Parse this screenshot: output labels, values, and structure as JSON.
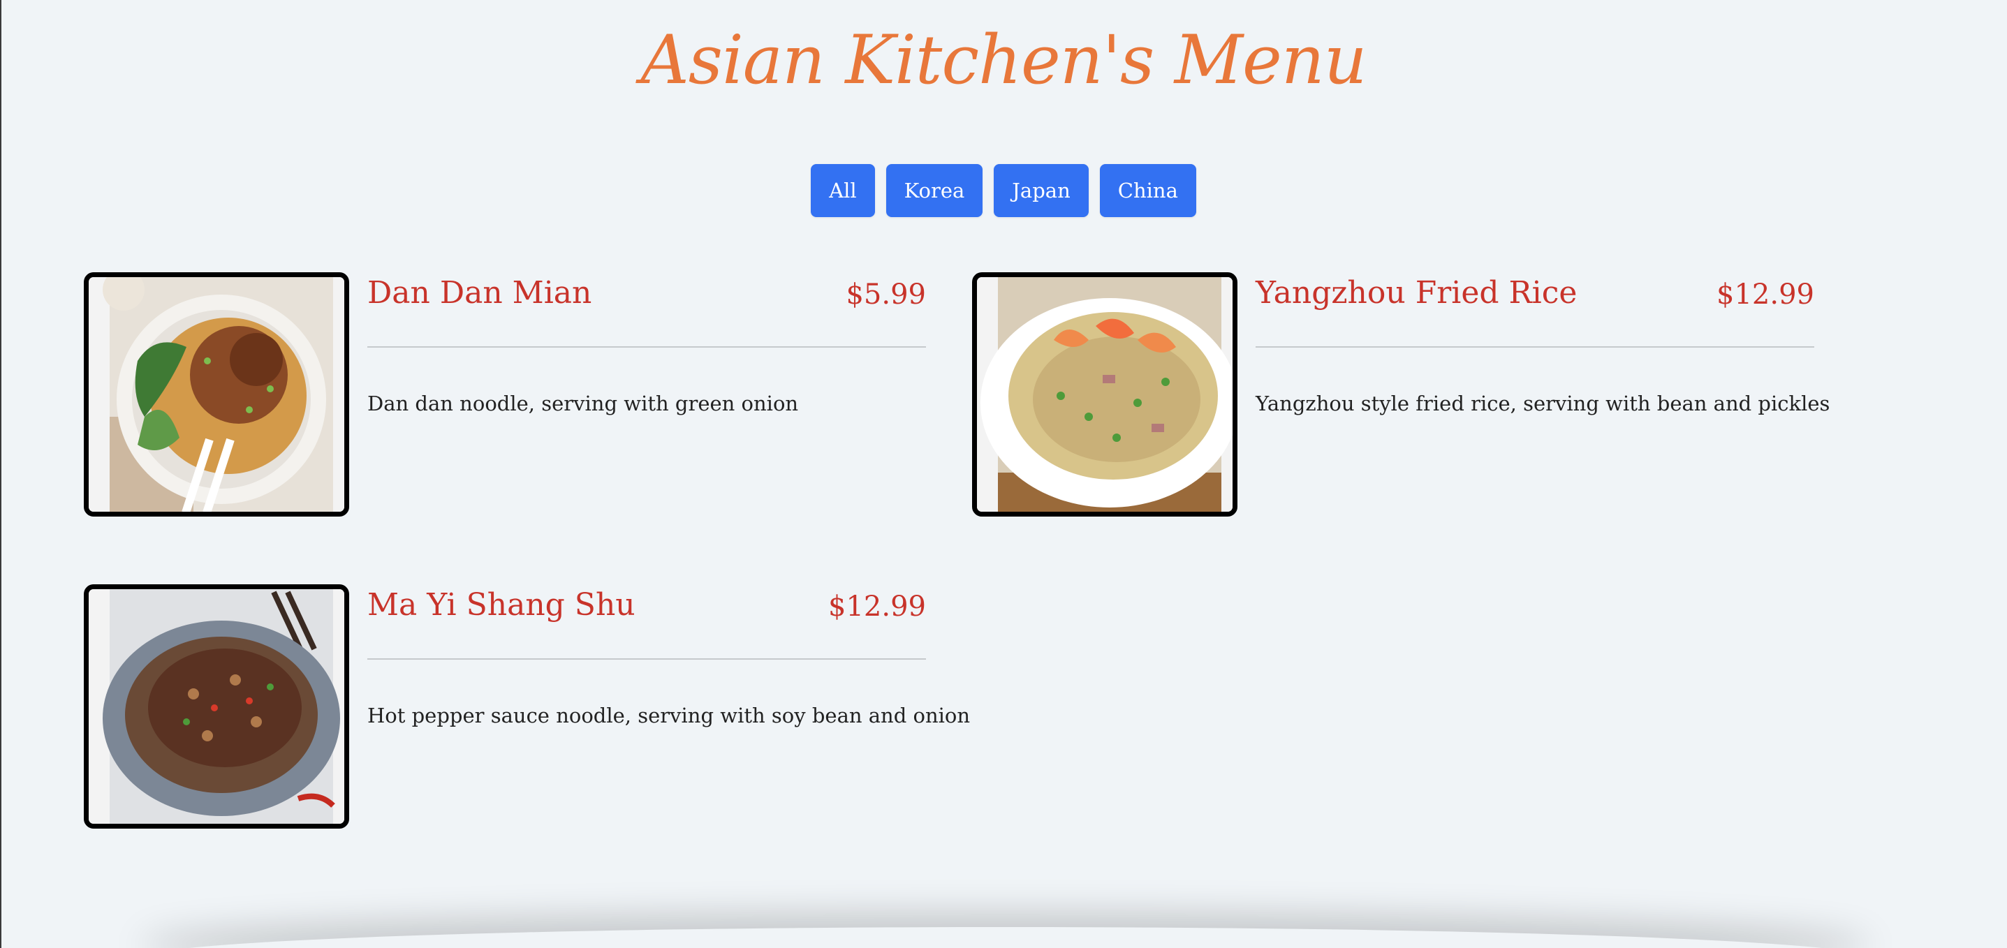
{
  "page": {
    "title": "Asian Kitchen's Menu"
  },
  "filters": [
    {
      "label": "All"
    },
    {
      "label": "Korea"
    },
    {
      "label": "Japan"
    },
    {
      "label": "China"
    }
  ],
  "menu": [
    {
      "name": "Dan Dan Mian",
      "price": "$5.99",
      "description": "Dan dan noodle, serving with green onion",
      "image": "noodle-bowl-photo"
    },
    {
      "name": "Yangzhou Fried Rice",
      "price": "$12.99",
      "description": "Yangzhou style fried rice, serving with bean and pickles",
      "image": "fried-rice-photo"
    },
    {
      "name": "Ma Yi Shang Shu",
      "price": "$12.99",
      "description": "Hot pepper sauce noodle, serving with soy bean and onion",
      "image": "glass-noodle-photo"
    }
  ],
  "colors": {
    "title": "#e8773a",
    "button": "#3371f2",
    "accent": "#c8332a",
    "background": "#f0f4f7"
  }
}
